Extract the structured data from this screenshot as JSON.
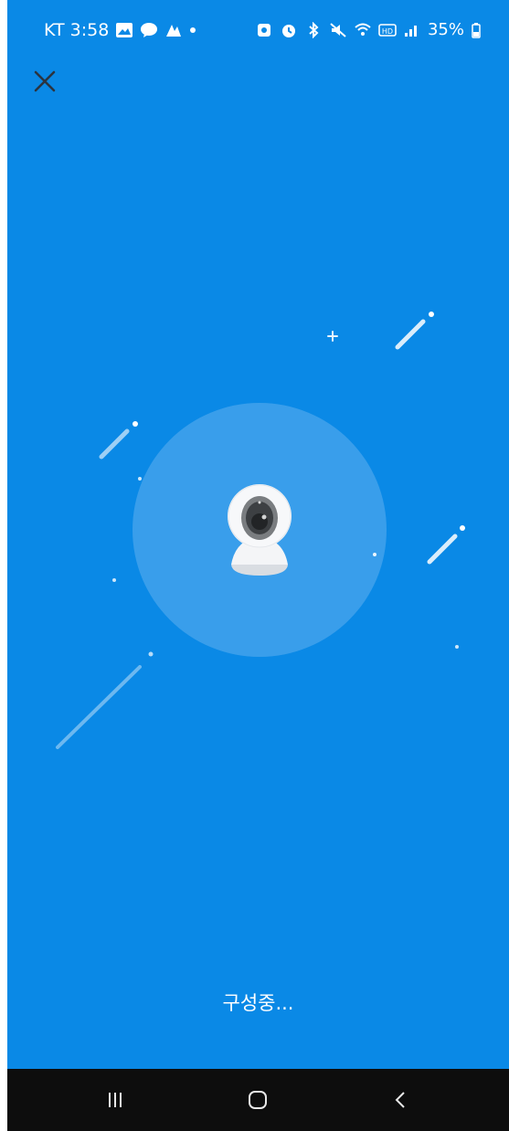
{
  "statusbar": {
    "carrier_time": "KT 3:58",
    "battery": "35%",
    "left_icons": [
      "gallery-icon",
      "talk-icon",
      "app-icon",
      "dot-icon"
    ],
    "right_icons": [
      "alarm-icon",
      "alarm-clock-icon",
      "bluetooth-icon",
      "mute-icon",
      "wifi-icon",
      "hd-icon",
      "signal-icon",
      "battery-icon"
    ]
  },
  "main": {
    "status_text": "구성중...",
    "background_color": "#0a89e6"
  },
  "navbar": {
    "buttons": [
      "recent-apps-icon",
      "home-icon",
      "back-icon"
    ]
  }
}
